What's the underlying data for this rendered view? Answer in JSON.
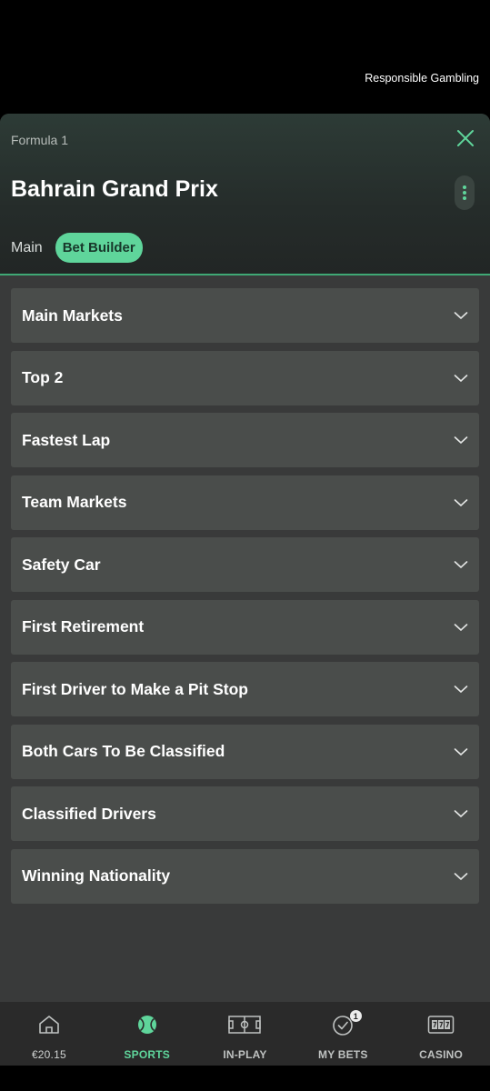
{
  "header": {
    "responsible_gambling": "Responsible Gambling"
  },
  "event": {
    "sport": "Formula 1",
    "title": "Bahrain Grand Prix",
    "tabs": [
      {
        "label": "Main",
        "active": false
      },
      {
        "label": "Bet Builder",
        "active": true
      }
    ]
  },
  "markets": [
    {
      "label": "Main Markets"
    },
    {
      "label": "Top 2"
    },
    {
      "label": "Fastest Lap"
    },
    {
      "label": "Team Markets"
    },
    {
      "label": "Safety Car"
    },
    {
      "label": "First Retirement"
    },
    {
      "label": "First Driver to Make a Pit Stop"
    },
    {
      "label": "Both Cars To Be Classified"
    },
    {
      "label": "Classified Drivers"
    },
    {
      "label": "Winning Nationality"
    }
  ],
  "bottom_nav": {
    "balance": "€20.15",
    "sports": "SPORTS",
    "in_play": "IN-PLAY",
    "my_bets": "MY BETS",
    "my_bets_badge": "1",
    "casino": "CASINO"
  },
  "colors": {
    "accent": "#5fd59b",
    "divider": "#3fa874",
    "market_bg": "#4a4d4b",
    "sheet_bg": "#393a3a"
  },
  "icons": {
    "close": "close-icon",
    "more": "kebab-icon",
    "chevron": "chevron-down-icon",
    "home": "home-icon",
    "sports": "tennis-ball-icon",
    "in_play": "pitch-icon",
    "my_bets": "check-circle-icon",
    "casino": "slot-machine-icon"
  }
}
